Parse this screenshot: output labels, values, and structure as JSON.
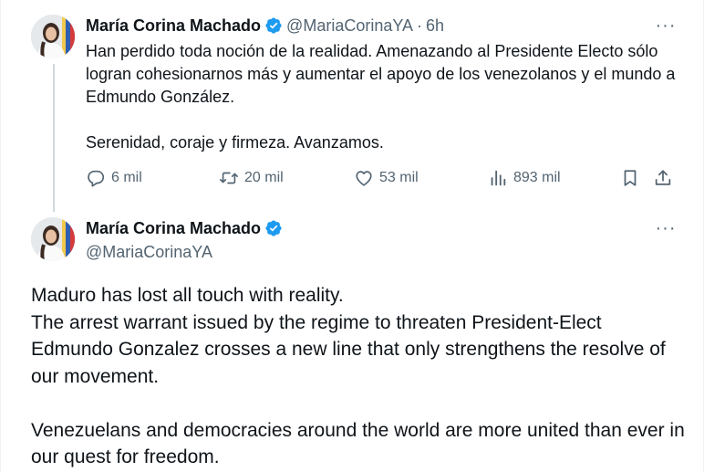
{
  "reply_tweet": {
    "author_name": "María Corina Machado",
    "handle": "@MariaCorinaYA",
    "separator": "·",
    "time": "6h",
    "more_label": "···",
    "paragraphs": [
      "Han perdido toda noción de la realidad. Amenazando al Presidente Electo sólo logran cohesionarnos más y aumentar el apoyo de los venezolanos y el mundo a Edmundo González.",
      "Serenidad, coraje y firmeza. Avanzamos."
    ],
    "stats": {
      "replies": "6 mil",
      "reposts": "20 mil",
      "likes": "53 mil",
      "views": "893 mil"
    },
    "icons": [
      "reply-icon",
      "repost-icon",
      "like-icon",
      "views-icon",
      "bookmark-icon",
      "share-icon"
    ]
  },
  "main_tweet": {
    "author_name": "María Corina Machado",
    "handle": "@MariaCorinaYA",
    "more_label": "···",
    "paragraphs": [
      "Maduro has lost all touch with reality.",
      "The arrest warrant issued by the regime to threaten President-Elect Edmundo Gonzalez crosses a new line that only strengthens the resolve of our movement.",
      "Venezuelans and democracies around the world are more united than ever in our quest for freedom."
    ]
  },
  "colors": {
    "verified_badge": "#1d9bf0",
    "secondary_text": "#536471",
    "primary_text": "#0f1419",
    "thread_line": "#cfd9de"
  }
}
